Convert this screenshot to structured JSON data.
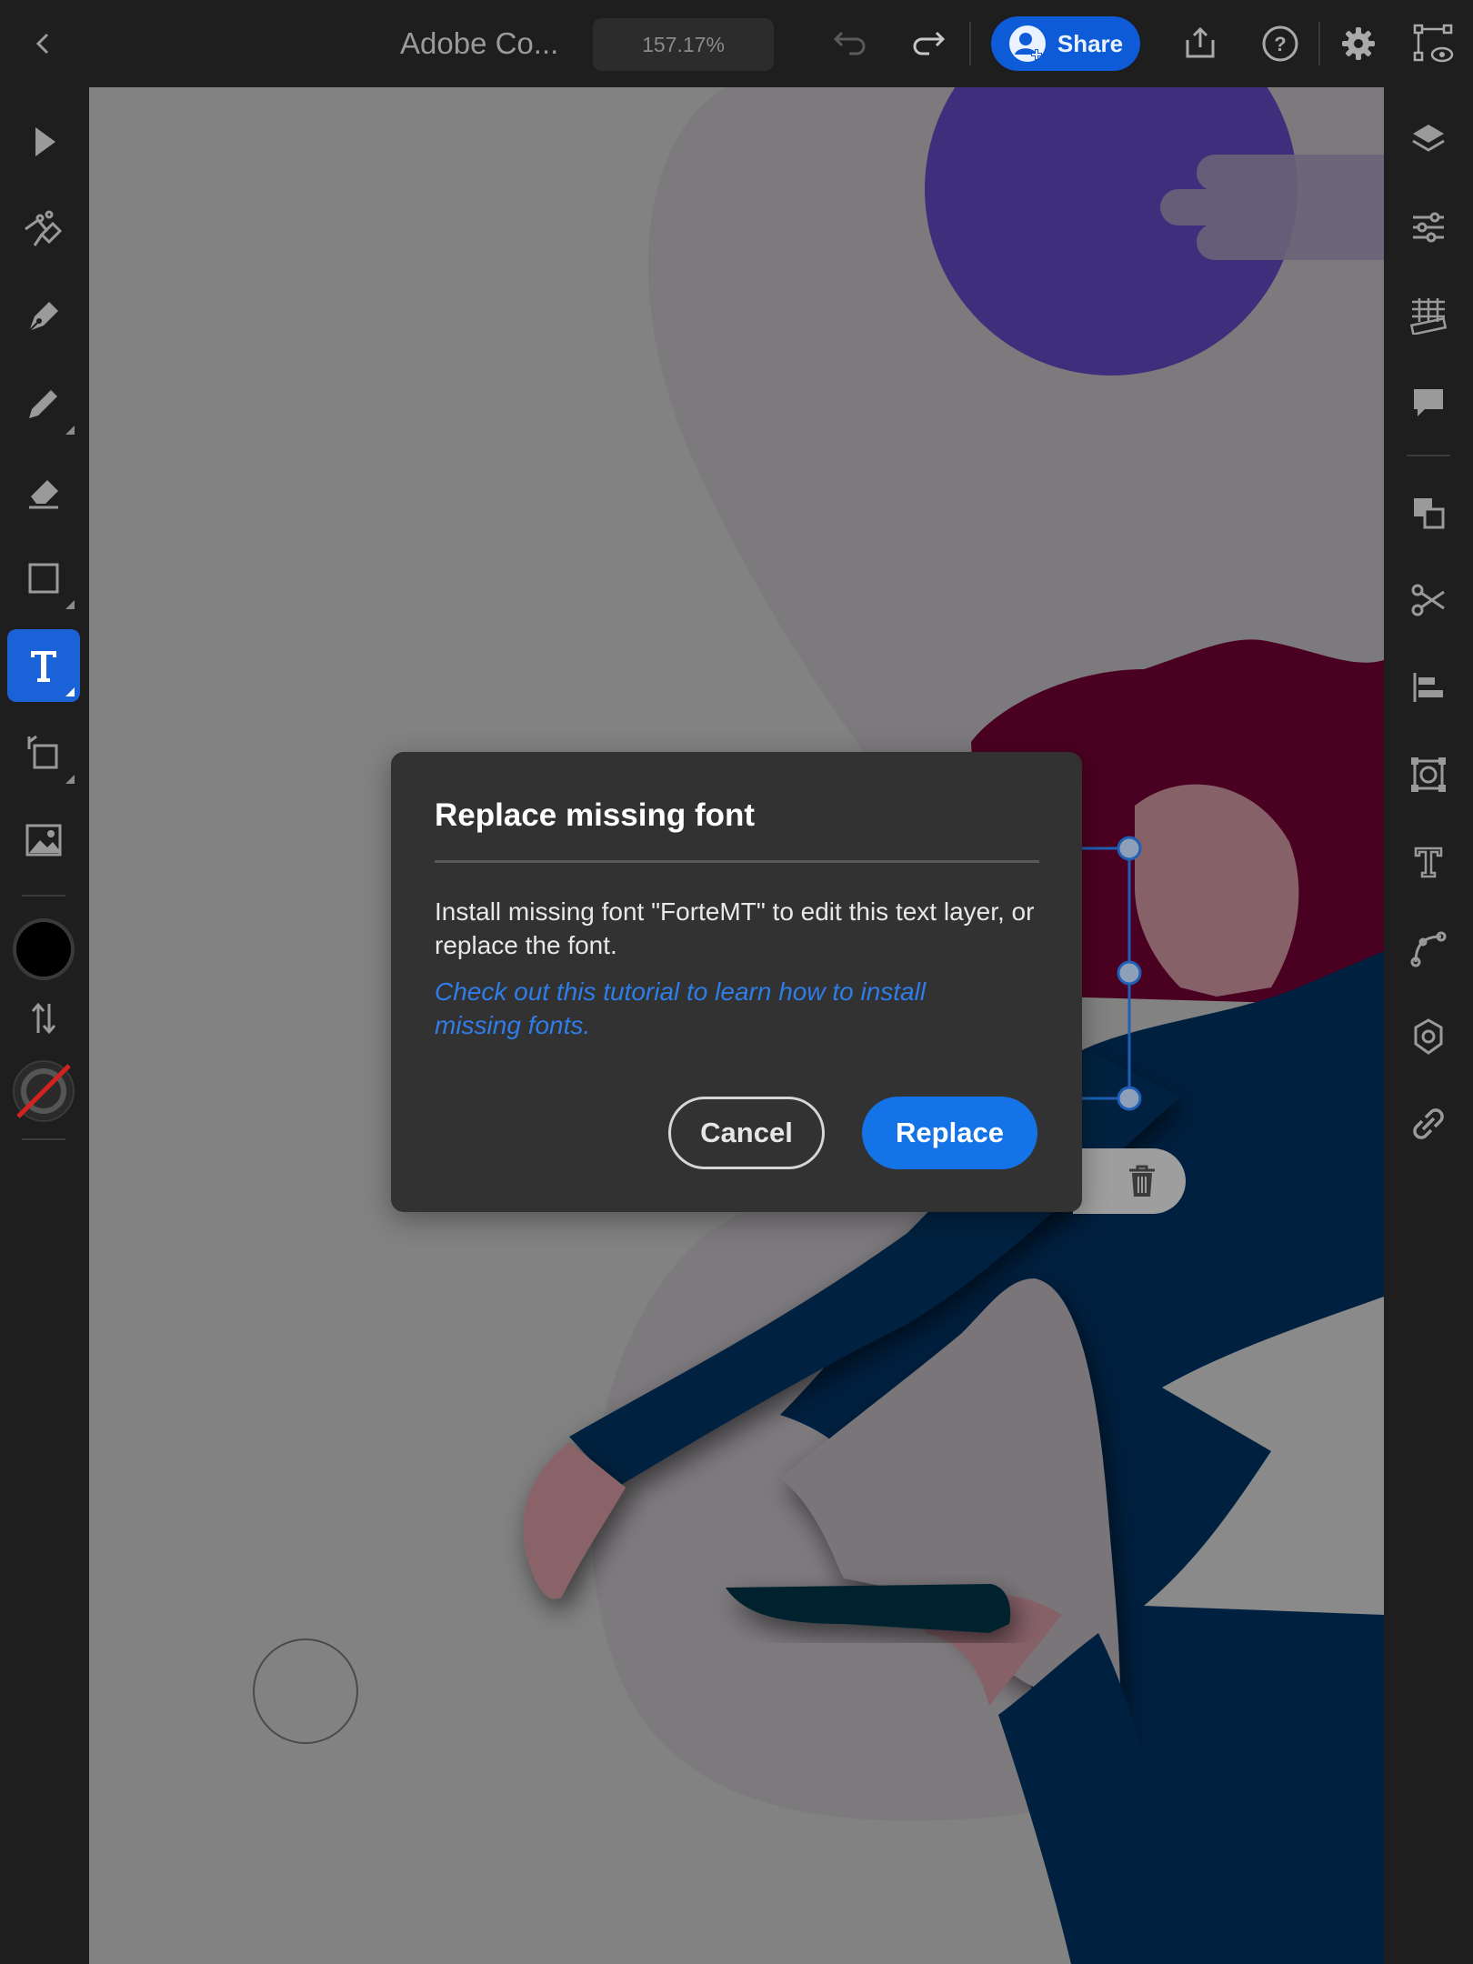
{
  "app": {
    "document_title": "Adobe Co...",
    "zoom_level": "157.17%",
    "share_label": "Share"
  },
  "left_toolbar": {
    "tools": [
      {
        "name": "select",
        "icon": "pointer-icon"
      },
      {
        "name": "vector-brush",
        "icon": "vector-brush-icon"
      },
      {
        "name": "pen",
        "icon": "pen-icon"
      },
      {
        "name": "pencil",
        "icon": "pencil-icon"
      },
      {
        "name": "eraser",
        "icon": "eraser-icon"
      },
      {
        "name": "rectangle",
        "icon": "rectangle-icon"
      },
      {
        "name": "text",
        "icon": "text-tool-icon",
        "active": true
      },
      {
        "name": "transform",
        "icon": "transform-icon"
      },
      {
        "name": "image",
        "icon": "image-icon"
      }
    ],
    "fill_color": "#000000",
    "stroke_color": "none"
  },
  "right_toolbar": {
    "items": [
      "layers-icon",
      "properties-icon",
      "grid-icon",
      "comments-icon",
      "arrange-icon",
      "scissors-icon",
      "align-icon",
      "clip-icon",
      "text-properties-icon",
      "path-icon",
      "repeat-icon",
      "link-icon"
    ]
  },
  "dialog": {
    "title": "Replace missing font",
    "body": "Install missing font \"ForteMT\" to edit this text layer, or replace the font.",
    "link": "Check out this tutorial to learn how to install missing fonts.",
    "cancel_label": "Cancel",
    "replace_label": "Replace"
  },
  "colors": {
    "accent": "#1473e6",
    "share_bg": "#0d5bd6",
    "dialog_bg": "#323232",
    "link": "#2f7de8"
  }
}
